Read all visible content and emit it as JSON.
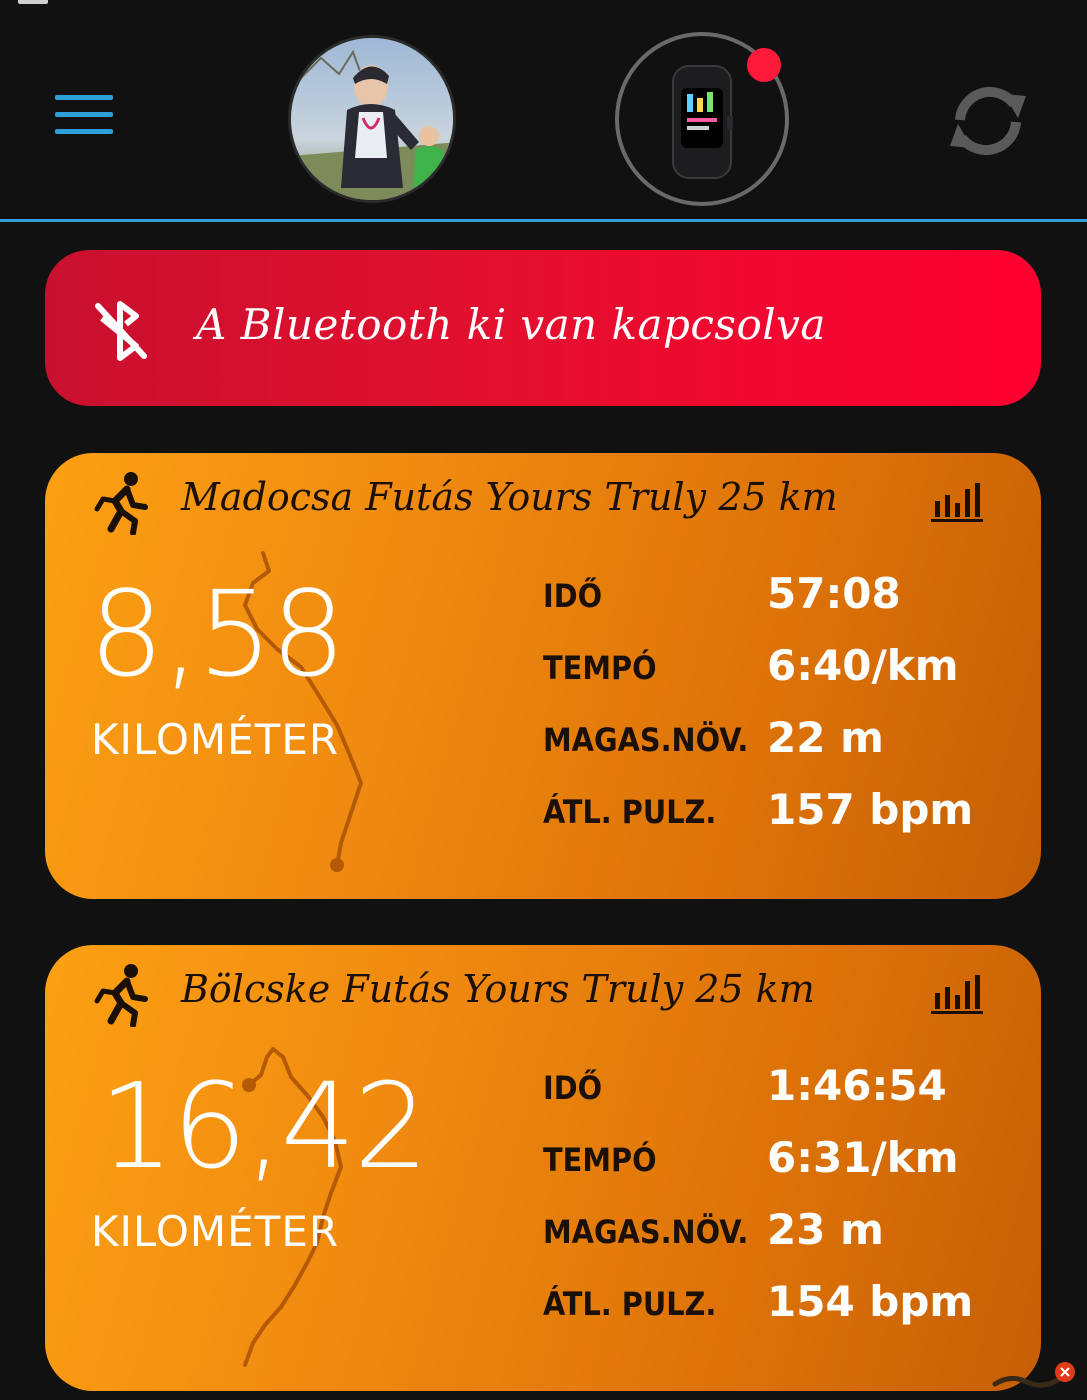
{
  "header": {
    "menu_icon": "hamburger-menu-icon",
    "sync_icon": "sync-icon",
    "device_status_color": "#ff1a3c",
    "accent_color": "#2e9fd8"
  },
  "banner": {
    "text": "A Bluetooth ki van kapcsolva",
    "icon": "bluetooth-disabled-icon",
    "color": "#e3102f"
  },
  "activities": [
    {
      "title": "Madocsa Futás Yours Truly 25 km",
      "distance": "8,58",
      "unit": "KILOMÉTER",
      "stats": [
        {
          "label": "IDŐ",
          "value": "57:08"
        },
        {
          "label": "TEMPÓ",
          "value": "6:40/km"
        },
        {
          "label": "MAGAS.NÖV.",
          "value": "22 m"
        },
        {
          "label": "ÁTL. PULZ.",
          "value": "157 bpm"
        }
      ]
    },
    {
      "title": "Bölcske Futás Yours Truly 25 km",
      "distance": "16,42",
      "unit": "KILOMÉTER",
      "stats": [
        {
          "label": "IDŐ",
          "value": "1:46:54"
        },
        {
          "label": "TEMPÓ",
          "value": "6:31/km"
        },
        {
          "label": "MAGAS.NÖV.",
          "value": "23 m"
        },
        {
          "label": "ÁTL. PULZ.",
          "value": "154 bpm"
        }
      ]
    }
  ],
  "card_color": "#f08a10"
}
